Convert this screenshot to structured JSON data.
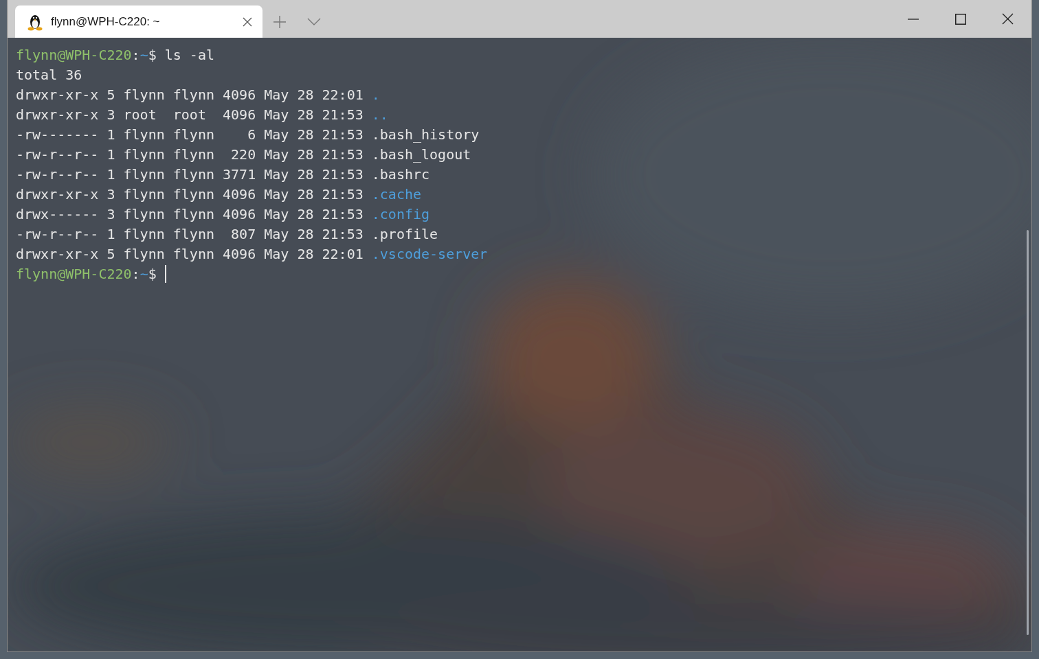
{
  "window": {
    "tabs": [
      {
        "title": "flynn@WPH-C220: ~",
        "selected": true
      }
    ]
  },
  "terminal": {
    "lines": [
      {
        "kind": "prompt",
        "user": "flynn@WPH-C220",
        "separator": ":",
        "path": "~",
        "symbol": "$",
        "command": "ls -al"
      },
      {
        "kind": "text",
        "text": "total 36"
      },
      {
        "kind": "entry",
        "details": "drwxr-xr-x 5 flynn flynn 4096 May 28 22:01",
        "name": ".",
        "directory": true
      },
      {
        "kind": "entry",
        "details": "drwxr-xr-x 3 root  root  4096 May 28 21:53",
        "name": "..",
        "directory": true
      },
      {
        "kind": "entry",
        "details": "-rw------- 1 flynn flynn    6 May 28 21:53",
        "name": ".bash_history",
        "directory": false
      },
      {
        "kind": "entry",
        "details": "-rw-r--r-- 1 flynn flynn  220 May 28 21:53",
        "name": ".bash_logout",
        "directory": false
      },
      {
        "kind": "entry",
        "details": "-rw-r--r-- 1 flynn flynn 3771 May 28 21:53",
        "name": ".bashrc",
        "directory": false
      },
      {
        "kind": "entry",
        "details": "drwxr-xr-x 3 flynn flynn 4096 May 28 21:53",
        "name": ".cache",
        "directory": true
      },
      {
        "kind": "entry",
        "details": "drwx------ 3 flynn flynn 4096 May 28 21:53",
        "name": ".config",
        "directory": true
      },
      {
        "kind": "entry",
        "details": "-rw-r--r-- 1 flynn flynn  807 May 28 21:53",
        "name": ".profile",
        "directory": false
      },
      {
        "kind": "entry",
        "details": "drwxr-xr-x 5 flynn flynn 4096 May 28 22:01",
        "name": ".vscode-server",
        "directory": true
      },
      {
        "kind": "prompt",
        "user": "flynn@WPH-C220",
        "separator": ":",
        "path": "~",
        "symbol": "$",
        "cursor": true
      }
    ]
  }
}
